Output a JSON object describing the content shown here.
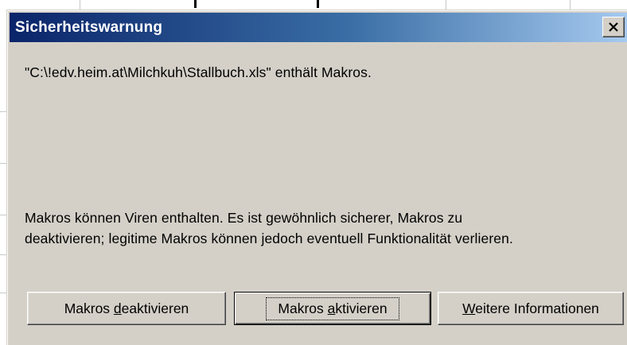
{
  "dialog": {
    "title": "Sicherheitswarnung",
    "close_icon": "close-icon",
    "file_message": "\"C:\\!edv.heim.at\\Milchkuh\\Stallbuch.xls\" enthält Makros.",
    "warning_line1": "Makros können Viren enthalten. Es ist gewöhnlich sicherer, Makros zu",
    "warning_line2": "deaktivieren; legitime Makros können jedoch eventuell Funktionalität verlieren."
  },
  "buttons": {
    "disable_pre": "Makros ",
    "disable_accel": "d",
    "disable_post": "eaktivieren",
    "enable_pre": "Makros ",
    "enable_accel": "a",
    "enable_post": "ktivieren",
    "info_accel": "W",
    "info_post": "eitere Informationen"
  },
  "colors": {
    "titlebar_start": "#0a246a",
    "titlebar_end": "#a6caf0",
    "dialog_face": "#d4d0c8"
  }
}
